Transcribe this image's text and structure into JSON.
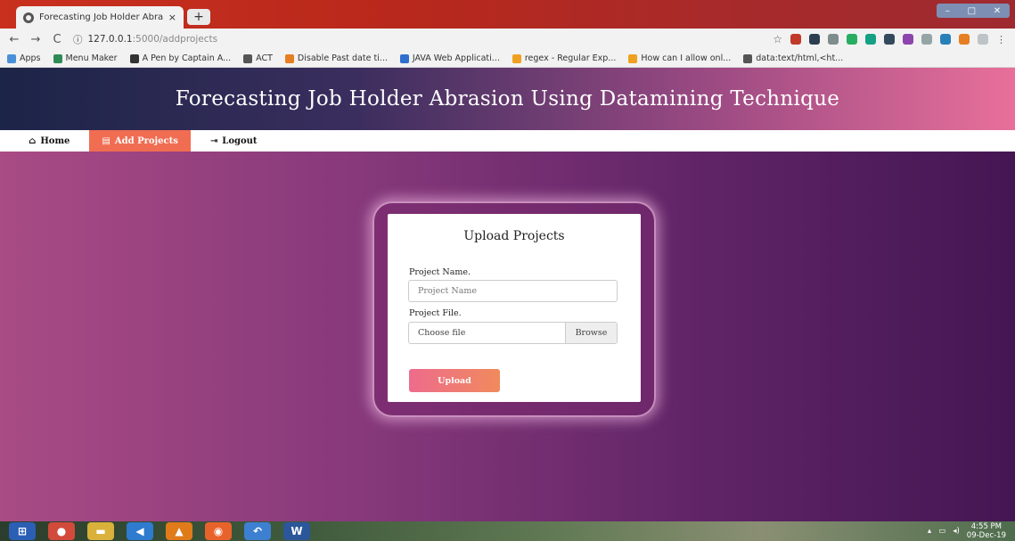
{
  "browser": {
    "tab_title": "Forecasting Job Holder Abrasion",
    "tab_close": "×",
    "new_tab": "+",
    "window_controls": [
      "–",
      "□",
      "✕"
    ],
    "url_host": "127.0.0.1",
    "url_rest": ":5000/addprojects",
    "bookmarks": [
      {
        "label": "Apps",
        "color": "#4a90d9"
      },
      {
        "label": "Menu Maker",
        "color": "#2e8b57"
      },
      {
        "label": "A Pen by Captain A...",
        "color": "#333333"
      },
      {
        "label": "ACT",
        "color": "#555555"
      },
      {
        "label": "Disable Past date ti...",
        "color": "#e67e22"
      },
      {
        "label": "JAVA Web Applicati...",
        "color": "#2f6fcf"
      },
      {
        "label": "regex - Regular Exp...",
        "color": "#f0a020"
      },
      {
        "label": "How can I allow onl...",
        "color": "#f0a020"
      },
      {
        "label": "data:text/html,<ht...",
        "color": "#555555"
      }
    ],
    "extension_colors": [
      "#c0392b",
      "#2c3e50",
      "#7f8c8d",
      "#27ae60",
      "#16a085",
      "#34495e",
      "#8e44ad",
      "#95a5a6",
      "#2980b9",
      "#e67e22",
      "#bdc3c7"
    ]
  },
  "site": {
    "title": "Forecasting Job Holder Abrasion Using Datamining Technique",
    "nav": [
      {
        "label": "Home",
        "icon": "home-icon",
        "glyph": "⌂"
      },
      {
        "label": "Add Projects",
        "icon": "file-icon",
        "glyph": "▤"
      },
      {
        "label": "Logout",
        "icon": "logout-icon",
        "glyph": "⇥"
      }
    ],
    "accent": "#f06d52"
  },
  "form": {
    "heading": "Upload Projects",
    "name_label": "Project Name.",
    "name_placeholder": "Project Name",
    "file_label": "Project File.",
    "file_placeholder": "Choose file",
    "browse_label": "Browse",
    "submit_label": "Upload"
  },
  "taskbar": {
    "apps": [
      {
        "name": "start-button-icon",
        "color": "#2b5fb5",
        "glyph": "⊞"
      },
      {
        "name": "chrome-icon",
        "color": "#d24a3b",
        "glyph": "●"
      },
      {
        "name": "folder-icon",
        "color": "#d9b13b",
        "glyph": "▬"
      },
      {
        "name": "vscode-icon",
        "color": "#2e7bcf",
        "glyph": "◀"
      },
      {
        "name": "vlc-icon",
        "color": "#e07b1a",
        "glyph": "▲"
      },
      {
        "name": "firefox-icon",
        "color": "#e8632b",
        "glyph": "◉"
      },
      {
        "name": "back-arrow-app-icon",
        "color": "#3d7fd1",
        "glyph": "↶"
      },
      {
        "name": "word-icon",
        "color": "#2b579a",
        "glyph": "W"
      }
    ],
    "time": "4:55 PM",
    "date": "09-Dec-19"
  }
}
